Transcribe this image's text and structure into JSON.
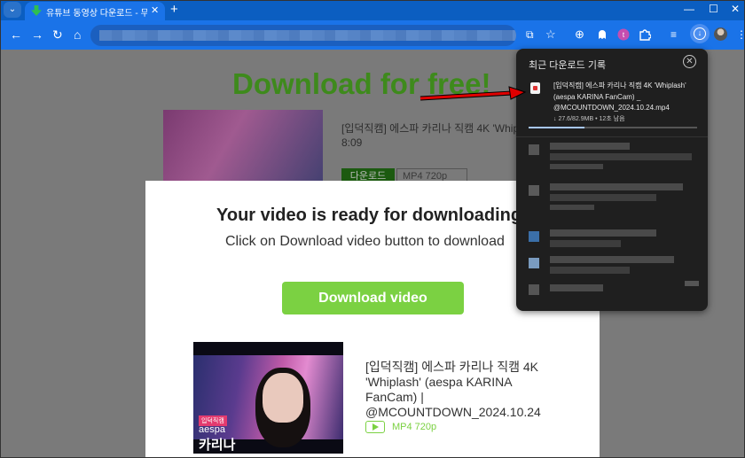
{
  "browser": {
    "tab_title": "유튜브 동영상 다운로드 - 무료",
    "tab_close": "✕",
    "new_tab": "+",
    "window_controls": [
      "—",
      "☐",
      "✕"
    ],
    "tab_menu": "⌄"
  },
  "page": {
    "bg_heading": "Download for free!",
    "bg_video_title": "[입덕직캠] 에스파 카리나 직캠 4K 'Whip",
    "bg_duration": "8:09",
    "bg_download_button": "다운로드",
    "bg_format": "MP4 720p"
  },
  "modal": {
    "title": "Your video is ready for downloading",
    "subtitle": "Click on Download video button to download",
    "download_button": "Download video",
    "thumb_badge": "입덕직캠",
    "thumb_name_en": "aespa",
    "thumb_name_ko": "카리나",
    "video_title": "[입덕직캠] 에스파 카리나 직캠 4K 'Whiplash' (aespa KARINA FanCam) | @MCOUNTDOWN_2024.10.24",
    "format": "MP4 720p"
  },
  "downloads": {
    "heading": "최근 다운로드 기록",
    "close_label": "✕",
    "file_name": "[입덕직캠] 에스파 카리나 직캠 4K 'Whiplash' (aespa KARINA FanCam) _ @MCOUNTDOWN_2024.10.24.mp4",
    "status": "↓ 27.6/82.9MB • 12초 남음",
    "progress": 0.33
  },
  "colors": {
    "tab_bar": "#0b5ec1",
    "toolbar": "#1a73e8",
    "accent_green": "#7bd142",
    "panel_bg": "#1f1f1f",
    "annotation_arrow": "#e00000"
  },
  "icons": [
    "back-icon",
    "forward-icon",
    "reload-icon",
    "home-icon",
    "install-icon",
    "star-icon",
    "globe-icon",
    "extension-icon",
    "puzzle-icon",
    "media-icon",
    "download-icon",
    "menu-icon"
  ]
}
